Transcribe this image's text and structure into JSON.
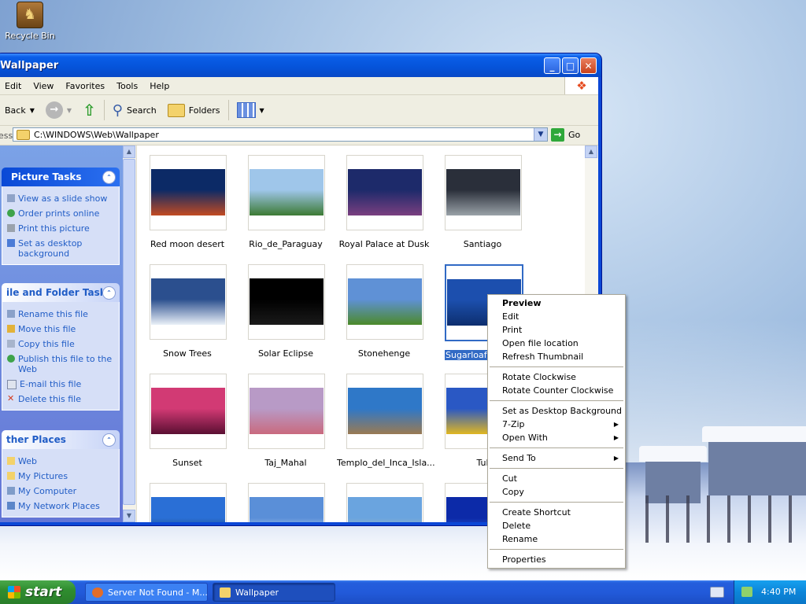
{
  "desktop": {
    "icons": [
      {
        "label": "Recycle Bin",
        "icon": "recycle-bin-icon"
      }
    ]
  },
  "window": {
    "title": "Wallpaper",
    "menu": [
      "Edit",
      "View",
      "Favorites",
      "Tools",
      "Help"
    ],
    "toolbar": {
      "back": "Back",
      "search": "Search",
      "folders": "Folders"
    },
    "address": {
      "label": "ess",
      "path": "C:\\WINDOWS\\Web\\Wallpaper",
      "go": "Go"
    },
    "panels": [
      {
        "title": "Picture Tasks",
        "items": [
          "View as a slide show",
          "Order prints online",
          "Print this picture",
          "Set as desktop background"
        ]
      },
      {
        "title": "ile and Folder Tasks",
        "items": [
          "Rename this file",
          "Move this file",
          "Copy this file",
          "Publish this file to the Web",
          "E-mail this file",
          "Delete this file"
        ]
      },
      {
        "title": "ther Places",
        "items": [
          "Web",
          "My Pictures",
          "My Computer",
          "My Network Places"
        ]
      }
    ],
    "files": [
      {
        "name": "Red moon desert",
        "colors": [
          "#0c2a66",
          "#c24a22"
        ]
      },
      {
        "name": "Rio_de_Paraguay",
        "colors": [
          "#9fc6ea",
          "#3c7a34"
        ]
      },
      {
        "name": "Royal Palace at Dusk",
        "colors": [
          "#1d2a6a",
          "#7a3f80"
        ]
      },
      {
        "name": "Santiago",
        "colors": [
          "#2a2f3a",
          "#9aa2a8"
        ]
      },
      {
        "name": "Snow Trees",
        "colors": [
          "#2b4f8e",
          "#eaf0f8"
        ]
      },
      {
        "name": "Solar Eclipse",
        "colors": [
          "#000000",
          "#1a1a1a"
        ]
      },
      {
        "name": "Stonehenge",
        "colors": [
          "#5f91d6",
          "#4c8a2a"
        ]
      },
      {
        "name": "Sugarloaf",
        "colors": [
          "#1c4fae",
          "#0d2e6e"
        ]
      },
      {
        "name": "Sunset",
        "colors": [
          "#d23a74",
          "#5a0f32"
        ]
      },
      {
        "name": "Taj_Mahal",
        "colors": [
          "#b89ac6",
          "#c96a7e"
        ]
      },
      {
        "name": "Templo_del_Inca_Isla...",
        "colors": [
          "#2f78c8",
          "#9a7a52"
        ]
      },
      {
        "name": "Tul",
        "colors": [
          "#2a58c4",
          "#e0b722"
        ]
      },
      {
        "name": "",
        "colors": [
          "#2a6fd6",
          "#1a3040"
        ]
      },
      {
        "name": "",
        "colors": [
          "#5a8fd8",
          "#f2f2f2"
        ]
      },
      {
        "name": "",
        "colors": [
          "#6aa4df",
          "#d6c49a"
        ]
      },
      {
        "name": "",
        "colors": [
          "#0c2aa8",
          "#3a80ff"
        ]
      }
    ],
    "selected_file_index": 7
  },
  "context_menu": {
    "items": [
      {
        "label": "Preview",
        "bold": true
      },
      {
        "label": "Edit"
      },
      {
        "label": "Print"
      },
      {
        "label": "Open file location"
      },
      {
        "label": "Refresh Thumbnail"
      },
      {
        "sep": true
      },
      {
        "label": "Rotate Clockwise"
      },
      {
        "label": "Rotate Counter Clockwise"
      },
      {
        "sep": true
      },
      {
        "label": "Set as Desktop Background"
      },
      {
        "label": "7-Zip",
        "submenu": true
      },
      {
        "label": "Open With",
        "submenu": true
      },
      {
        "sep": true
      },
      {
        "label": "Send To",
        "submenu": true
      },
      {
        "sep": true
      },
      {
        "label": "Cut"
      },
      {
        "label": "Copy"
      },
      {
        "sep": true
      },
      {
        "label": "Create Shortcut"
      },
      {
        "label": "Delete"
      },
      {
        "label": "Rename"
      },
      {
        "sep": true
      },
      {
        "label": "Properties"
      }
    ]
  },
  "taskbar": {
    "start_label": "start",
    "tasks": [
      {
        "label": "Server Not Found - M..."
      },
      {
        "label": "Wallpaper"
      }
    ],
    "clock": "4:40 PM"
  },
  "colors": {
    "selection": "#316ac5",
    "task_link": "#215dc6",
    "titlebar": "#0553d9"
  }
}
